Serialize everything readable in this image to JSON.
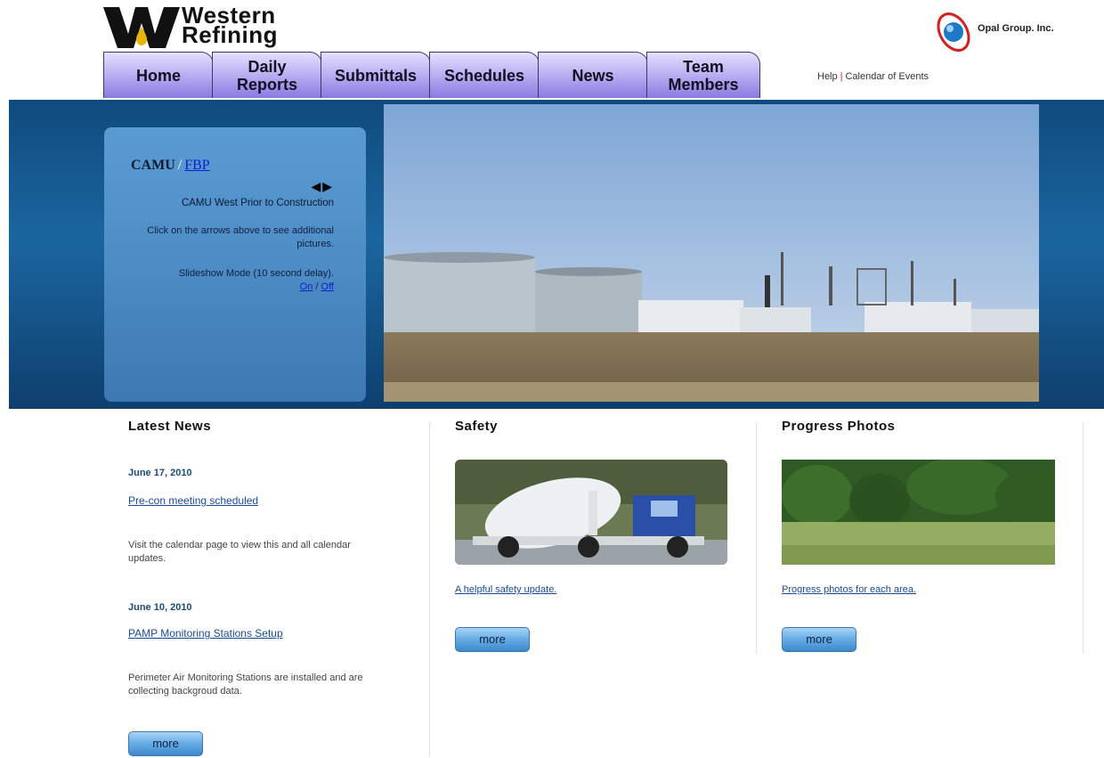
{
  "header": {
    "brand_line1": "Western",
    "brand_line2": "Refining",
    "partner_name": "Opal Group. Inc.",
    "util_help": "Help",
    "util_separator": "|",
    "util_calendar": "Calendar of Events"
  },
  "nav": {
    "tabs": [
      {
        "label": "Home"
      },
      {
        "label": "Daily Reports"
      },
      {
        "label": "Submittals"
      },
      {
        "label": "Schedules"
      },
      {
        "label": "News"
      },
      {
        "label": "Team Members"
      }
    ]
  },
  "slideshow": {
    "title_current": "CAMU",
    "title_separator": "/",
    "title_link": "FBP",
    "prev_arrow": "◀",
    "next_arrow": "▶",
    "caption": "CAMU West Prior to Construction",
    "hint": "Click on the arrows above to see additional pictures.",
    "mode_text": "Slideshow Mode (10 second delay).",
    "on_label": "On",
    "off_separator": "/",
    "off_label": "Off"
  },
  "news": {
    "heading": "Latest News",
    "items": [
      {
        "date": "June 17, 2010",
        "title": "Pre-con meeting scheduled",
        "body": "Visit the calendar page to view this and all calendar updates."
      },
      {
        "date": "June 10, 2010",
        "title": "PAMP Monitoring Stations Setup",
        "body": "Perimeter Air Monitoring Stations are installed and are collecting backgroud data."
      }
    ],
    "more_label": "more"
  },
  "safety": {
    "heading": "Safety",
    "link": "A helpful safety update.",
    "more_label": "more"
  },
  "progress": {
    "heading": "Progress Photos",
    "link": "Progress photos for each area.",
    "more_label": "more"
  },
  "colors": {
    "band": "#1b66a0",
    "tab": "#b4a8f0",
    "button": "#6aaee6",
    "link": "#1a4a9a"
  }
}
